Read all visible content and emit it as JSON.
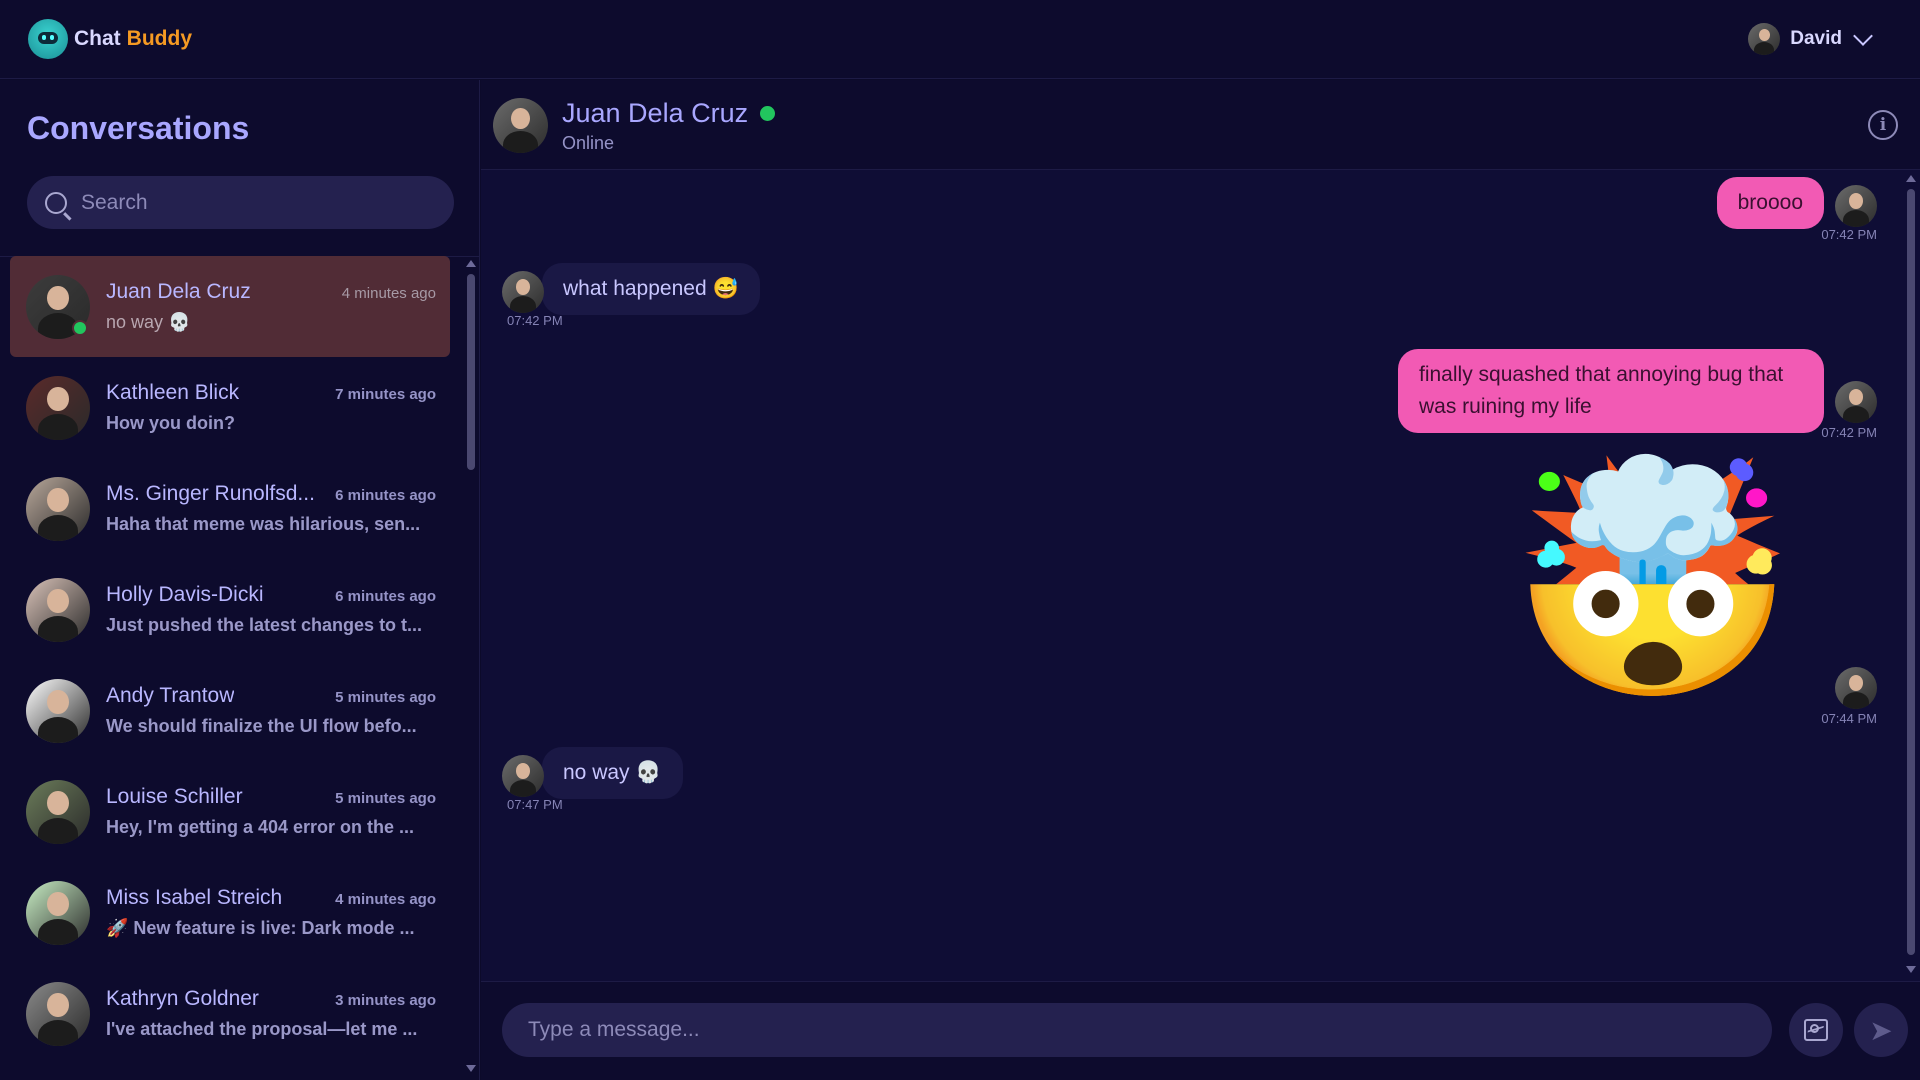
{
  "app": {
    "brand_word1": "Chat",
    "brand_word2": "Buddy",
    "user_name": "David"
  },
  "sidebar": {
    "title": "Conversations",
    "search_placeholder": "Search",
    "conversations": [
      {
        "name": "Juan Dela Cruz",
        "time": "4 minutes ago",
        "preview": "no way 💀",
        "active": true,
        "online": true,
        "avatar_color": "#3c3c3c"
      },
      {
        "name": "Kathleen Blick",
        "time": "7 minutes ago",
        "preview": "How you doin?",
        "active": false,
        "online": false,
        "avatar_color": "#5a2a2a"
      },
      {
        "name": "Ms. Ginger Runolfsd...",
        "time": "6 minutes ago",
        "preview": "Haha that meme was hilarious, sen...",
        "active": false,
        "online": false,
        "avatar_color": "#b8a79a"
      },
      {
        "name": "Holly Davis-Dicki",
        "time": "6 minutes ago",
        "preview": "Just pushed the latest changes to t...",
        "active": false,
        "online": false,
        "avatar_color": "#d9c2b8"
      },
      {
        "name": "Andy Trantow",
        "time": "5 minutes ago",
        "preview": "We should finalize the UI flow befo...",
        "active": false,
        "online": false,
        "avatar_color": "#ffffff"
      },
      {
        "name": "Louise Schiller",
        "time": "5 minutes ago",
        "preview": "Hey, I'm getting a 404 error on the ...",
        "active": false,
        "online": false,
        "avatar_color": "#6b7c5a"
      },
      {
        "name": "Miss Isabel Streich",
        "time": "4 minutes ago",
        "preview": "🚀 New feature is live: Dark mode ...",
        "active": false,
        "online": false,
        "avatar_color": "#c8eec4"
      },
      {
        "name": "Kathryn Goldner",
        "time": "3 minutes ago",
        "preview": "I've attached the proposal—let me ...",
        "active": false,
        "online": false,
        "avatar_color": "#8a8a8a"
      }
    ]
  },
  "chat": {
    "contact_name": "Juan Dela Cruz",
    "contact_status": "Online",
    "messages": [
      {
        "dir": "out",
        "text": "broooo",
        "time": "07:42 PM"
      },
      {
        "dir": "in",
        "text": "what happened 😅",
        "time": "07:42 PM"
      },
      {
        "dir": "out",
        "text": "finally squashed that annoying bug that was ruining my life",
        "time": "07:42 PM"
      },
      {
        "dir": "out",
        "emoji": "🤯",
        "time": "07:44 PM"
      },
      {
        "dir": "in",
        "text": "no way 💀",
        "time": "07:47 PM"
      }
    ],
    "composer_placeholder": "Type a message..."
  },
  "icons": {
    "search": "search-icon",
    "info": "info-icon",
    "image": "image-icon",
    "send": "send-icon",
    "chevron": "chevron-down-icon"
  },
  "colors": {
    "accent": "#f25ab4",
    "online": "#22c55e",
    "active_conversation": "#512c36",
    "brand_orange": "#f59a23"
  }
}
